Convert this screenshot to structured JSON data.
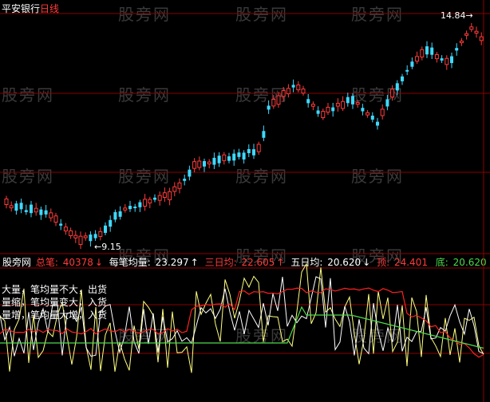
{
  "header": {
    "part1": "平安银行",
    "part2": "日线"
  },
  "colors": {
    "up": "#ff3b3b",
    "down": "#3fd9ff",
    "grid": "#8b0000",
    "yellow": "#ffff80",
    "white": "#ffffff",
    "green": "#4cd94c",
    "red": "#ff2020"
  },
  "price_labels": {
    "high": "14.84",
    "low": "9.15"
  },
  "indicator": {
    "brand": "股旁网",
    "items": [
      {
        "label": "总笔:",
        "value": "40378",
        "arrow": "↓",
        "color": "#ff3b3b"
      },
      {
        "label": "每笔均量:",
        "value": "23.297",
        "arrow": "↑",
        "color": "#ffffff"
      },
      {
        "label": "三日均:",
        "value": "22.605",
        "arrow": "↑",
        "color": "#ff3b3b"
      },
      {
        "label": "五日均:",
        "value": "20.620",
        "arrow": "↓",
        "color": "#ffffff"
      },
      {
        "label": "顶:",
        "value": "24.401",
        "arrow": "",
        "color": "#ff3b3b"
      },
      {
        "label": "底:",
        "value": "20.620",
        "arrow": "↓",
        "color": "#4cd94c"
      }
    ]
  },
  "notes": [
    "大量，笔均量不大，出货",
    "量缩，笔均量变大，入货",
    "量增，笔均量大增，入货"
  ],
  "watermark": "股旁网"
}
